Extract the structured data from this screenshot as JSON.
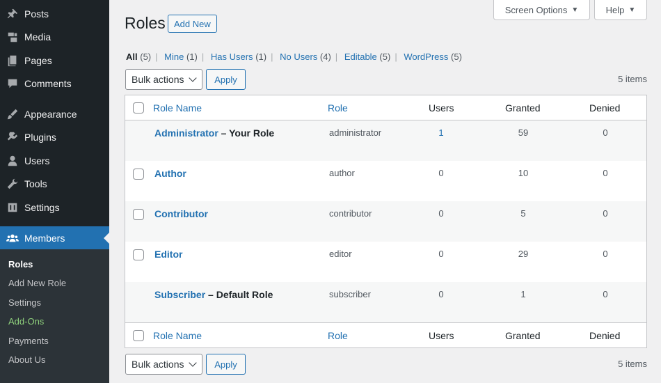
{
  "sidebar": {
    "items": [
      {
        "label": "Posts",
        "icon": "pin-icon"
      },
      {
        "label": "Media",
        "icon": "media-icon"
      },
      {
        "label": "Pages",
        "icon": "pages-icon"
      },
      {
        "label": "Comments",
        "icon": "comment-icon"
      },
      {
        "label": "Appearance",
        "icon": "brush-icon"
      },
      {
        "label": "Plugins",
        "icon": "plug-icon"
      },
      {
        "label": "Users",
        "icon": "user-icon"
      },
      {
        "label": "Tools",
        "icon": "wrench-icon"
      },
      {
        "label": "Settings",
        "icon": "settings-icon"
      },
      {
        "label": "Members",
        "icon": "groups-icon"
      }
    ],
    "submenu": [
      "Roles",
      "Add New Role",
      "Settings",
      "Add-Ons",
      "Payments",
      "About Us"
    ]
  },
  "top_buttons": {
    "screen_options": "Screen Options",
    "help": "Help"
  },
  "page": {
    "title": "Roles",
    "add_new": "Add New"
  },
  "filters": [
    {
      "label": "All",
      "count": "(5)"
    },
    {
      "label": "Mine",
      "count": "(1)"
    },
    {
      "label": "Has Users",
      "count": "(1)"
    },
    {
      "label": "No Users",
      "count": "(4)"
    },
    {
      "label": "Editable",
      "count": "(5)"
    },
    {
      "label": "WordPress",
      "count": "(5)"
    }
  ],
  "bulk": {
    "select_label": "Bulk actions",
    "apply": "Apply",
    "items_count": "5 items"
  },
  "table": {
    "columns": [
      "Role Name",
      "Role",
      "Users",
      "Granted",
      "Denied"
    ],
    "rows": [
      {
        "name": "Administrator",
        "suffix": " – Your Role",
        "role": "administrator",
        "users": "1",
        "granted": "59",
        "denied": "0"
      },
      {
        "name": "Author",
        "suffix": "",
        "role": "author",
        "users": "0",
        "granted": "10",
        "denied": "0"
      },
      {
        "name": "Contributor",
        "suffix": "",
        "role": "contributor",
        "users": "0",
        "granted": "5",
        "denied": "0"
      },
      {
        "name": "Editor",
        "suffix": "",
        "role": "editor",
        "users": "0",
        "granted": "29",
        "denied": "0"
      },
      {
        "name": "Subscriber",
        "suffix": " – Default Role",
        "role": "subscriber",
        "users": "0",
        "granted": "1",
        "denied": "0"
      }
    ]
  },
  "colors": {
    "sidebar_bg": "#1d2327",
    "accent": "#2271b1",
    "addons_green": "#8fd17d"
  }
}
